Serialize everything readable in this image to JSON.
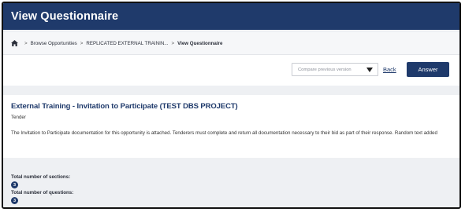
{
  "header": {
    "title": "View Questionnaire"
  },
  "breadcrumb": {
    "items": [
      "Browse Opportunities",
      "REPLICATED EXTERNAL TRAININ...",
      "View Questionnaire"
    ]
  },
  "toolbar": {
    "compare_placeholder": "Compare previous version",
    "back_label": "Back",
    "answer_label": "Answer"
  },
  "main": {
    "title": "External Training - Invitation to Participate (TEST DBS PROJECT)",
    "type": "Tender",
    "description": "The Invitation to Participate documentation for this opportunity is attached. Tenderers must complete and return all documentation necessary to their bid as part of their response. Random text added"
  },
  "stats": {
    "sections_label": "Total number of sections:",
    "sections_value": "3",
    "questions_label": "Total number of questions:",
    "questions_value": "3"
  },
  "colors": {
    "brand": "#1f3a6b",
    "background": "#eef0f3"
  },
  "icons": {
    "home": "home-icon",
    "dropdown": "caret-down-icon"
  }
}
